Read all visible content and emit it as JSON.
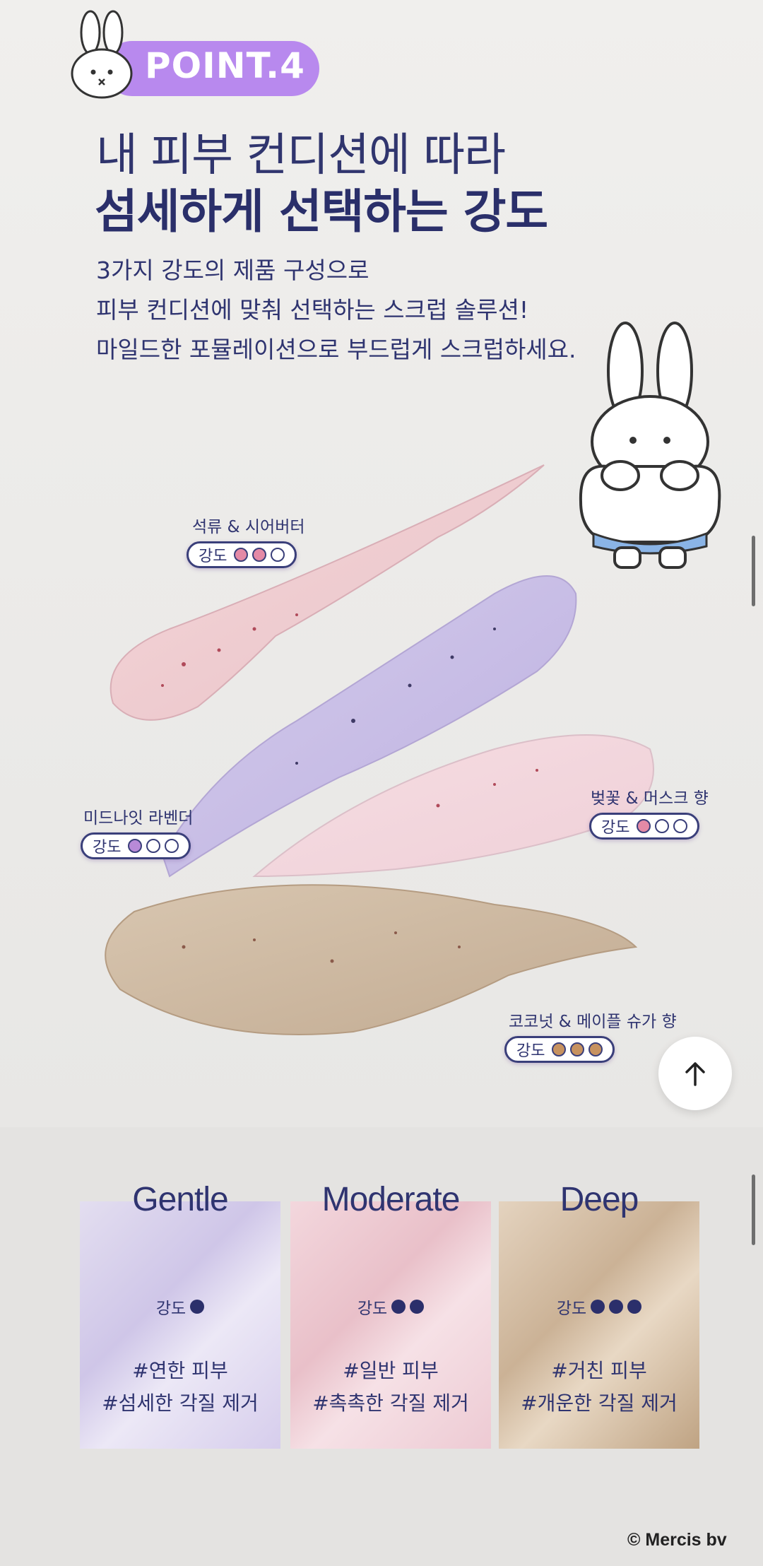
{
  "header": {
    "badge": "POINT.4",
    "headline_line1": "내 피부 컨디션에 따라",
    "headline_line2": "섬세하게 선택하는 강도",
    "description": [
      "3가지 강도의 제품 구성으로",
      "피부 컨디션에 맞춰 선택하는 스크럽 솔루션!",
      "마일드한 포뮬레이션으로 부드럽게 스크럽하세요."
    ]
  },
  "swatch_labels": [
    {
      "name": "석류 & 시어버터",
      "intensity_label": "강도",
      "level": 2,
      "max": 3,
      "color": "#e48aa6"
    },
    {
      "name": "미드나잇 라벤더",
      "intensity_label": "강도",
      "level": 1,
      "max": 3,
      "color": "#b88ad8"
    },
    {
      "name": "벚꽃 & 머스크 향",
      "intensity_label": "강도",
      "level": 1,
      "max": 3,
      "color": "#e48aa6"
    },
    {
      "name": "코코넛 & 메이플 슈가 향",
      "intensity_label": "강도",
      "level": 3,
      "max": 3,
      "color": "#c7925f"
    }
  ],
  "cards": [
    {
      "title": "Gentle",
      "intensity_label": "강도",
      "level": 1,
      "tag1": "#연한 피부",
      "tag2": "#섬세한 각질 제거"
    },
    {
      "title": "Moderate",
      "intensity_label": "강도",
      "level": 2,
      "tag1": "#일반 피부",
      "tag2": "#촉촉한 각질 제거"
    },
    {
      "title": "Deep",
      "intensity_label": "강도",
      "level": 3,
      "tag1": "#거친 피부",
      "tag2": "#개운한 각질 제거"
    }
  ],
  "footer": {
    "copyright": "© Mercis bv"
  },
  "icons": {
    "scroll_top": "arrow-up-icon"
  },
  "colors": {
    "accent": "#b889ee",
    "text": "#2b2f6b"
  }
}
